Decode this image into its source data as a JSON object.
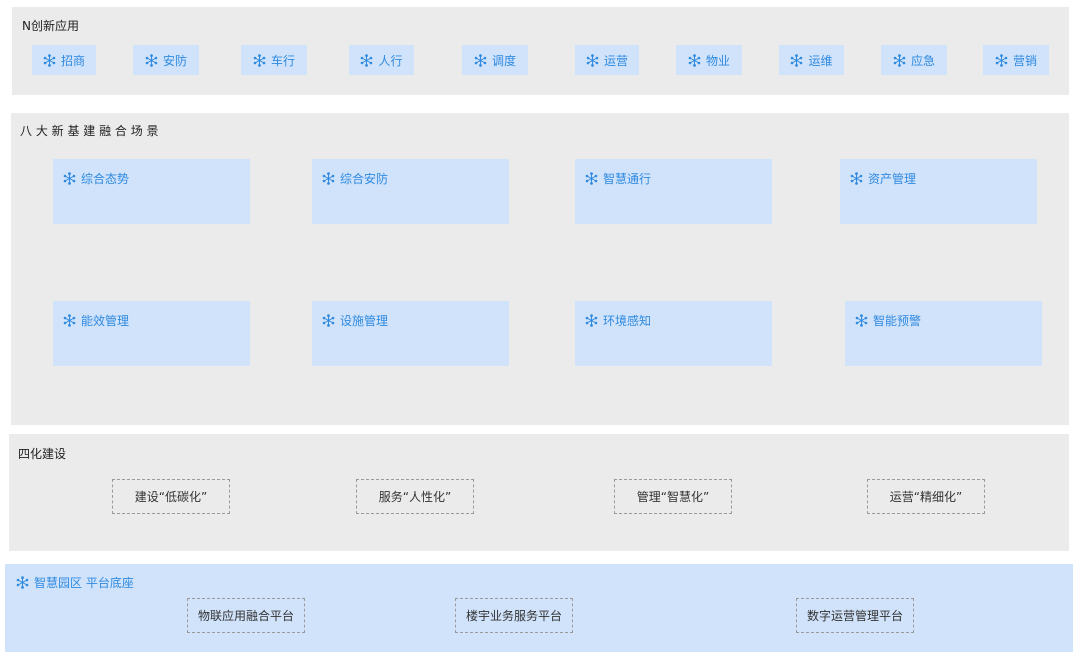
{
  "colors": {
    "accent": "#2f8ae0",
    "tile": "#d0e3fa",
    "panel": "#ebebec",
    "dash_border": "#9a9a9a"
  },
  "icon": "network-nodes-icon",
  "n_apps": {
    "title": "N创新应用",
    "items": [
      "招商",
      "安防",
      "车行",
      "人行",
      "调度",
      "运营",
      "物业",
      "运维",
      "应急",
      "营销"
    ]
  },
  "scenes": {
    "title": "八 大 新 基 建 融 合 场 景",
    "row1": [
      "综合态势",
      "综合安防",
      "智慧通行",
      "资产管理"
    ],
    "row2": [
      "能效管理",
      "设施管理",
      "环境感知",
      "智能预警"
    ]
  },
  "four": {
    "title": "四化建设",
    "items": [
      "建设“低碳化”",
      "服务“人性化”",
      "管理“智慧化”",
      "运营“精细化”"
    ]
  },
  "base": {
    "title": "智慧园区 平台底座",
    "items": [
      "物联应用融合平台",
      "楼宇业务服务平台",
      "数字运营管理平台"
    ]
  }
}
